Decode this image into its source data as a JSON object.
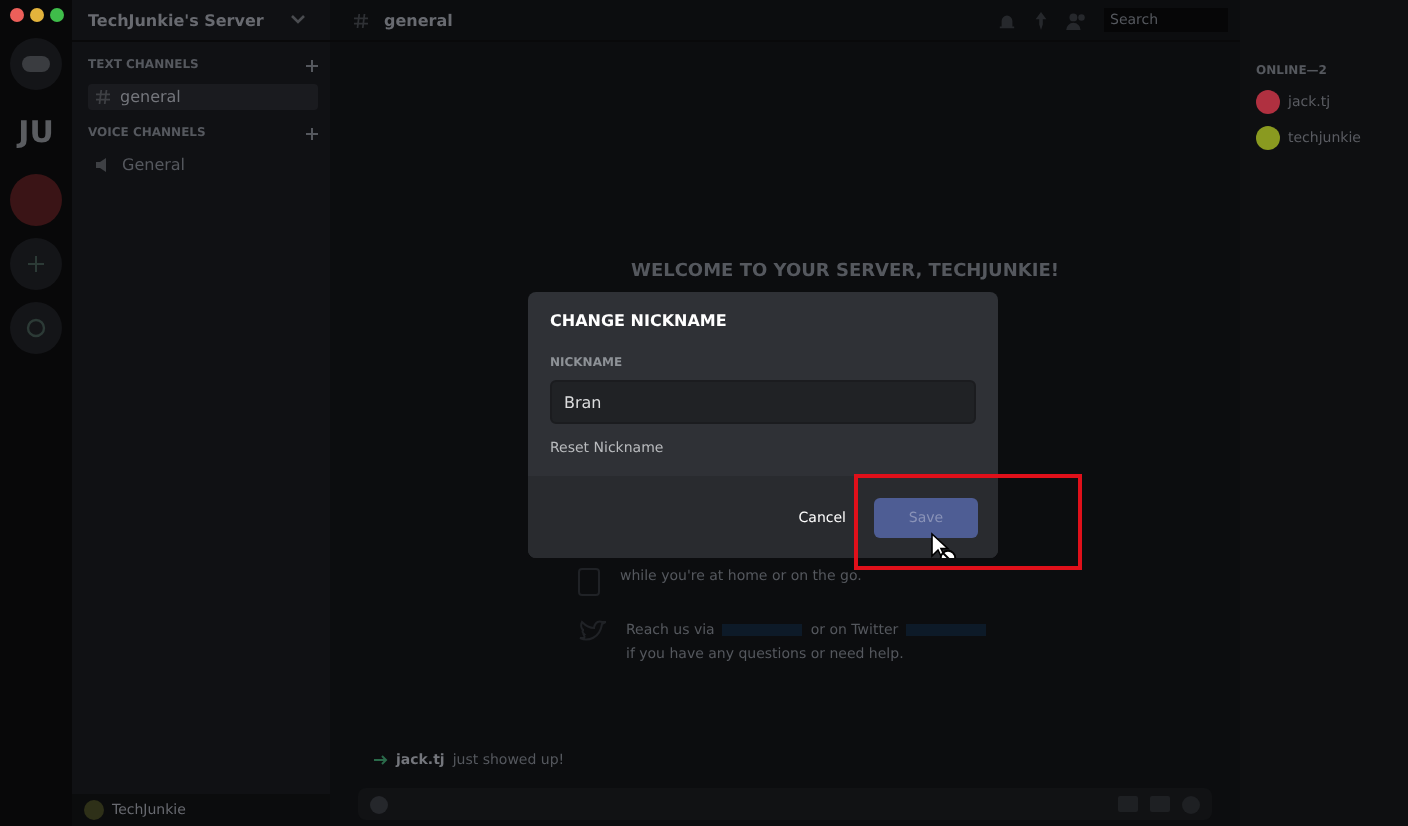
{
  "window": {
    "title": "TechJunkie's Server"
  },
  "servers": [
    {
      "kind": "home"
    },
    {
      "kind": "guild",
      "label": "JU"
    },
    {
      "kind": "avatar"
    },
    {
      "kind": "add"
    },
    {
      "kind": "explore"
    }
  ],
  "sidebar": {
    "categories": [
      {
        "name": "TEXT CHANNELS",
        "channels": [
          {
            "name": "general",
            "kind": "text",
            "selected": true
          }
        ]
      },
      {
        "name": "VOICE CHANNELS",
        "channels": [
          {
            "name": "General",
            "kind": "voice",
            "selected": false
          }
        ]
      }
    ],
    "user": "TechJunkie"
  },
  "header": {
    "channel": "general",
    "search": {
      "placeholder": "Search"
    }
  },
  "welcome": {
    "title": "WELCOME TO YOUR SERVER, TECHJUNKIE!",
    "lines": [
      "while you're at home or on the go.",
      "Reach us via",
      "or on Twitter",
      "if you have any questions or need help."
    ]
  },
  "messages": [
    {
      "author": "jack.tj",
      "text": "just showed up!"
    }
  ],
  "members": {
    "heading": "ONLINE—2",
    "list": [
      {
        "name": "jack.tj",
        "color": "#b03040"
      },
      {
        "name": "techjunkie",
        "color": "#8a9a20"
      }
    ]
  },
  "dialog": {
    "title": "CHANGE NICKNAME",
    "label": "NICKNAME",
    "value": "Bran",
    "reset": "Reset Nickname",
    "cancel": "Cancel",
    "save": "Save",
    "highlighted": true
  }
}
